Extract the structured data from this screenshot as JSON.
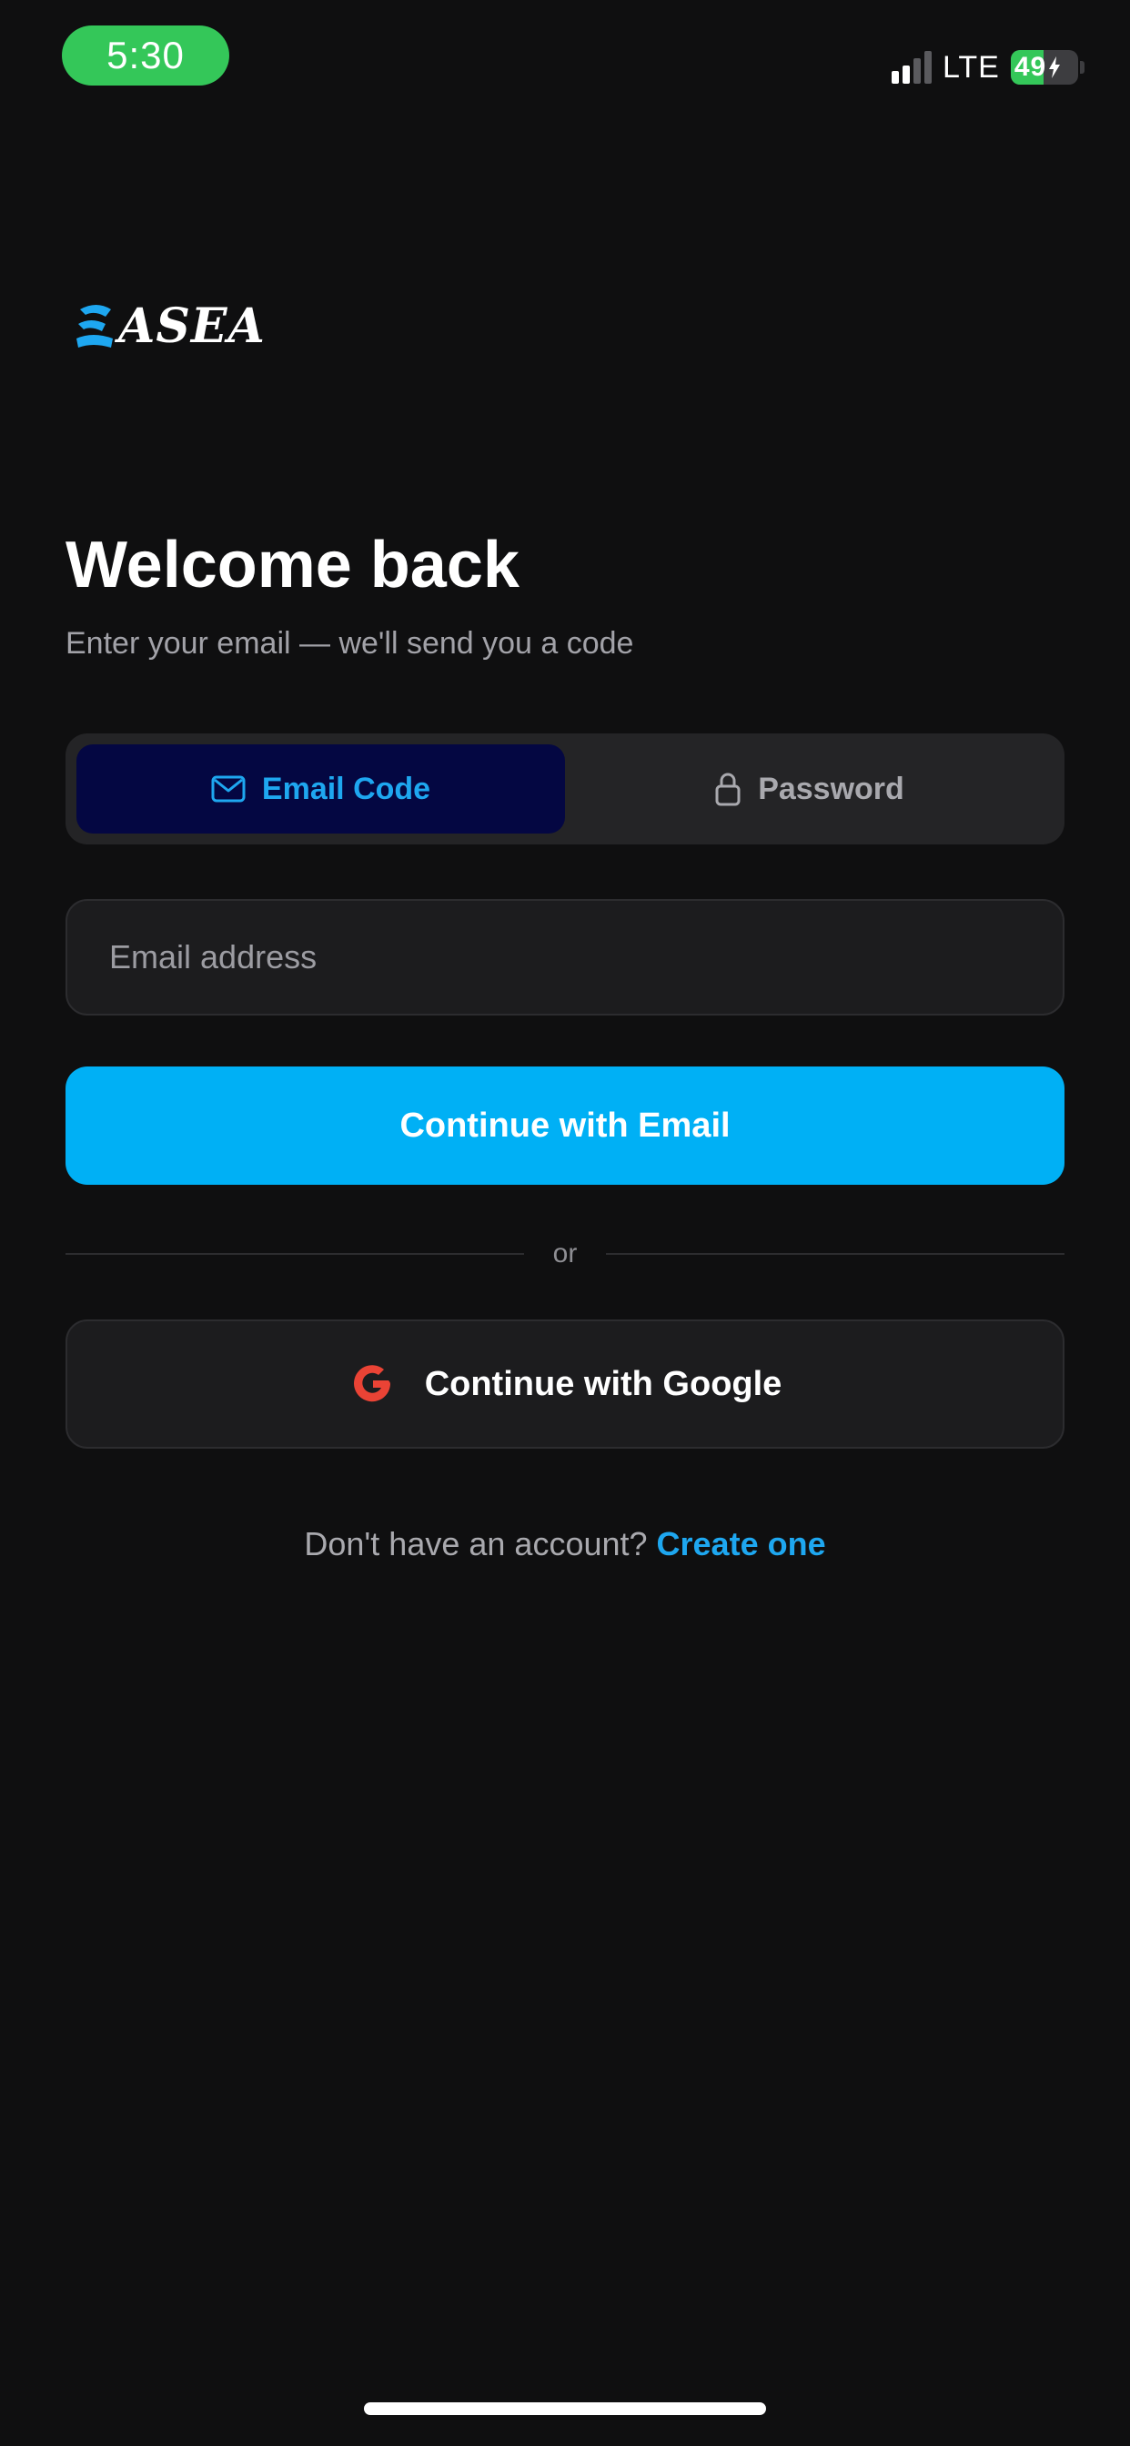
{
  "status_bar": {
    "time": "5:30",
    "network": "LTE",
    "battery_percent": "49",
    "battery_charging": true
  },
  "brand": {
    "name": "ASEA",
    "accent_color": "#00b0f5"
  },
  "header": {
    "title": "Welcome back",
    "subtitle": "Enter your email — we'll send you a code"
  },
  "tabs": [
    {
      "label": "Email Code",
      "icon": "mail-icon",
      "active": true
    },
    {
      "label": "Password",
      "icon": "lock-icon",
      "active": false
    }
  ],
  "form": {
    "email_placeholder": "Email address",
    "email_value": "",
    "submit_label": "Continue with Email"
  },
  "divider_text": "or",
  "google_button": {
    "label": "Continue with Google",
    "icon": "google-icon"
  },
  "signup": {
    "prompt": "Don't have an account?",
    "link_label": "Create one"
  },
  "colors": {
    "background": "#0f0f10",
    "primary": "#00b0f5",
    "link": "#1ea7f0",
    "active_tab_bg": "#040742",
    "google_red": "#ea4335",
    "status_green": "#34c759"
  }
}
